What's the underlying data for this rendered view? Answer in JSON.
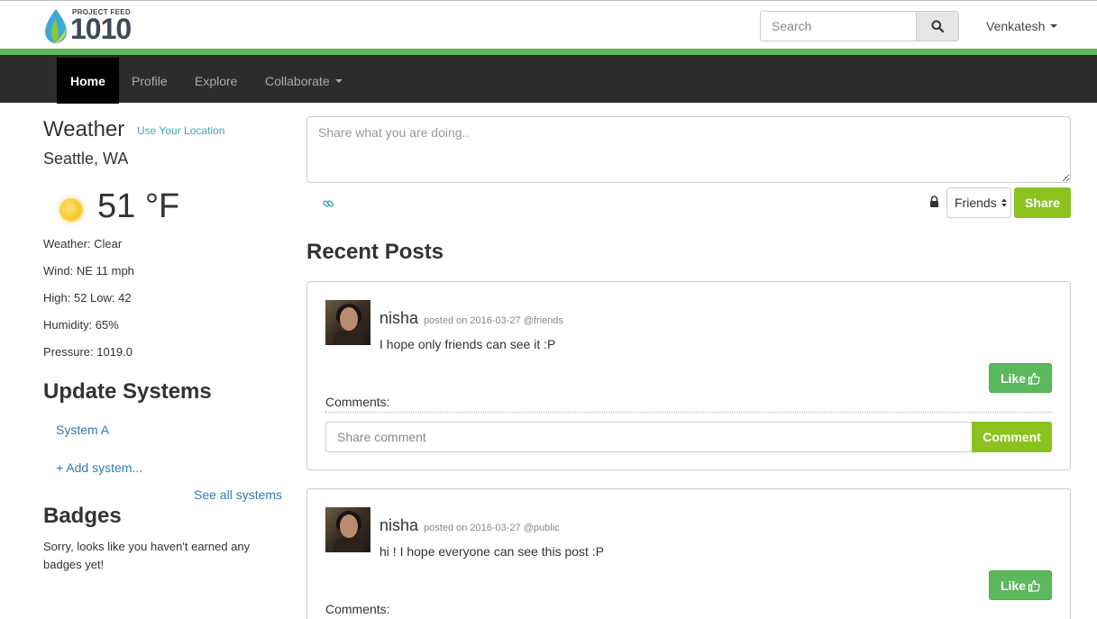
{
  "header": {
    "logo_small": "PROJECT FEED",
    "logo_big": "1010",
    "search_placeholder": "Search",
    "user_name": "Venkatesh"
  },
  "nav": {
    "items": [
      {
        "label": "Home",
        "active": true
      },
      {
        "label": "Profile"
      },
      {
        "label": "Explore"
      },
      {
        "label": "Collaborate",
        "dropdown": true
      }
    ]
  },
  "sidebar": {
    "weather_title": "Weather",
    "use_location": "Use Your Location",
    "city": "Seattle, WA",
    "temperature": "51 °F",
    "condition": "Weather: Clear",
    "wind": "Wind: NE 11 mph",
    "high_low": "High: 52 Low: 42",
    "humidity": "Humidity: 65%",
    "pressure": "Pressure: 1019.0",
    "update_title": "Update Systems",
    "systems": [
      "System A"
    ],
    "add_system": "+ Add system...",
    "see_all": "See all systems",
    "badges_title": "Badges",
    "badges_text": "Sorry, looks like you haven't earned any badges yet!"
  },
  "composer": {
    "placeholder": "Share what you are doing..",
    "privacy": "Friends",
    "share_label": "Share"
  },
  "recent_title": "Recent Posts",
  "posts": [
    {
      "author": "nisha",
      "meta": "posted on 2016-03-27  @friends",
      "body": "I hope only friends can see it :P",
      "like_label": "Like",
      "comments_label": "Comments:",
      "comment_placeholder": "Share comment",
      "comment_button": "Comment"
    },
    {
      "author": "nisha",
      "meta": "posted on 2016-03-27  @public",
      "body": "hi ! I hope everyone can see this post :P",
      "like_label": "Like",
      "comments_label": "Comments:"
    }
  ],
  "colors": {
    "accent_green": "#5cb85c",
    "lime_button": "#8cc21f",
    "link_blue": "#337ab7",
    "teal_link": "#3ba8b8",
    "navbar_bg": "#2c2c2c"
  },
  "icons": [
    "water-drop-leaf-logo",
    "search-icon",
    "sun-icon",
    "link-icon",
    "lock-icon",
    "thumbs-up-icon"
  ]
}
